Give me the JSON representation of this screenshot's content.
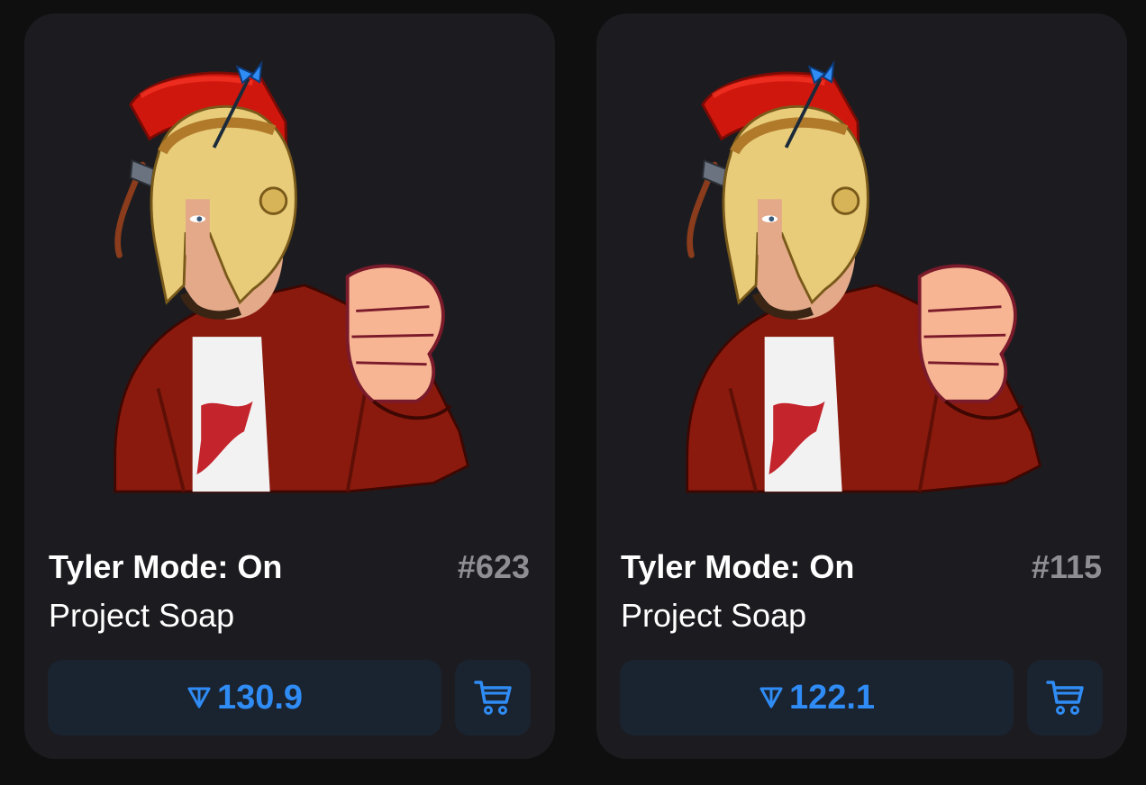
{
  "colors": {
    "page_background": "#0f0f10",
    "card_background": "#1c1c20",
    "button_background": "#1a2330",
    "accent": "#2f8cf5",
    "muted": "#8e8e93"
  },
  "items": [
    {
      "title": "Tyler Mode: On",
      "number": "#623",
      "collection": "Project Soap",
      "price": "130.9",
      "currency_icon": "ton-icon",
      "cart_icon": "cart-icon",
      "image": "spartan-helmet-character"
    },
    {
      "title": "Tyler Mode: On",
      "number": "#115",
      "collection": "Project Soap",
      "price": "122.1",
      "currency_icon": "ton-icon",
      "cart_icon": "cart-icon",
      "image": "spartan-helmet-character"
    }
  ]
}
